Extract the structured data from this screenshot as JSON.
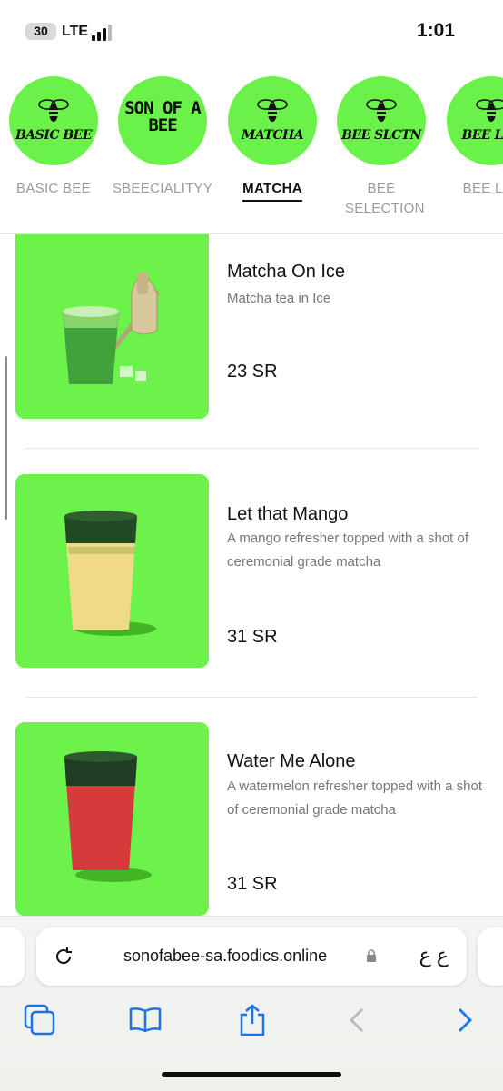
{
  "status_bar": {
    "battery": "30",
    "network": "LTE",
    "time": "1:01"
  },
  "categories": [
    {
      "label": "BASIC BEE",
      "logo_text": "BASIC BEE",
      "active": false
    },
    {
      "label": "SBEECIALITYY",
      "logo_text": "SON OF A BEE",
      "active": false
    },
    {
      "label": "MATCHA",
      "logo_text": "MATCHA",
      "active": true
    },
    {
      "label": "BEE SELECTION",
      "logo_text": "BEE SLCTN",
      "active": false
    },
    {
      "label": "BEE LAT",
      "logo_text": "BEE LAT",
      "active": false
    }
  ],
  "products": [
    {
      "name": "Matcha On Ice",
      "description": "Matcha tea in Ice",
      "price": "23 SR",
      "image": "matcha-iced-drink-with-whisk"
    },
    {
      "name": "Let that Mango",
      "description": "A mango refresher topped with a shot of ceremonial grade matcha",
      "price": "31 SR",
      "image": "mango-matcha-cup"
    },
    {
      "name": "Water Me Alone",
      "description": "A watermelon refresher topped with a shot of ceremonial grade matcha",
      "price": "31 SR",
      "image": "watermelon-matcha-cup"
    }
  ],
  "browser": {
    "url": "sonofabee-sa.foodics.online",
    "text_size_button": "ع ع",
    "toolbar_icons": [
      "tabs-icon",
      "bookmarks-icon",
      "share-icon",
      "back-icon",
      "forward-icon"
    ]
  },
  "colors": {
    "accent_green": "#6bf24a",
    "toolbar_blue": "#1a73e8"
  }
}
